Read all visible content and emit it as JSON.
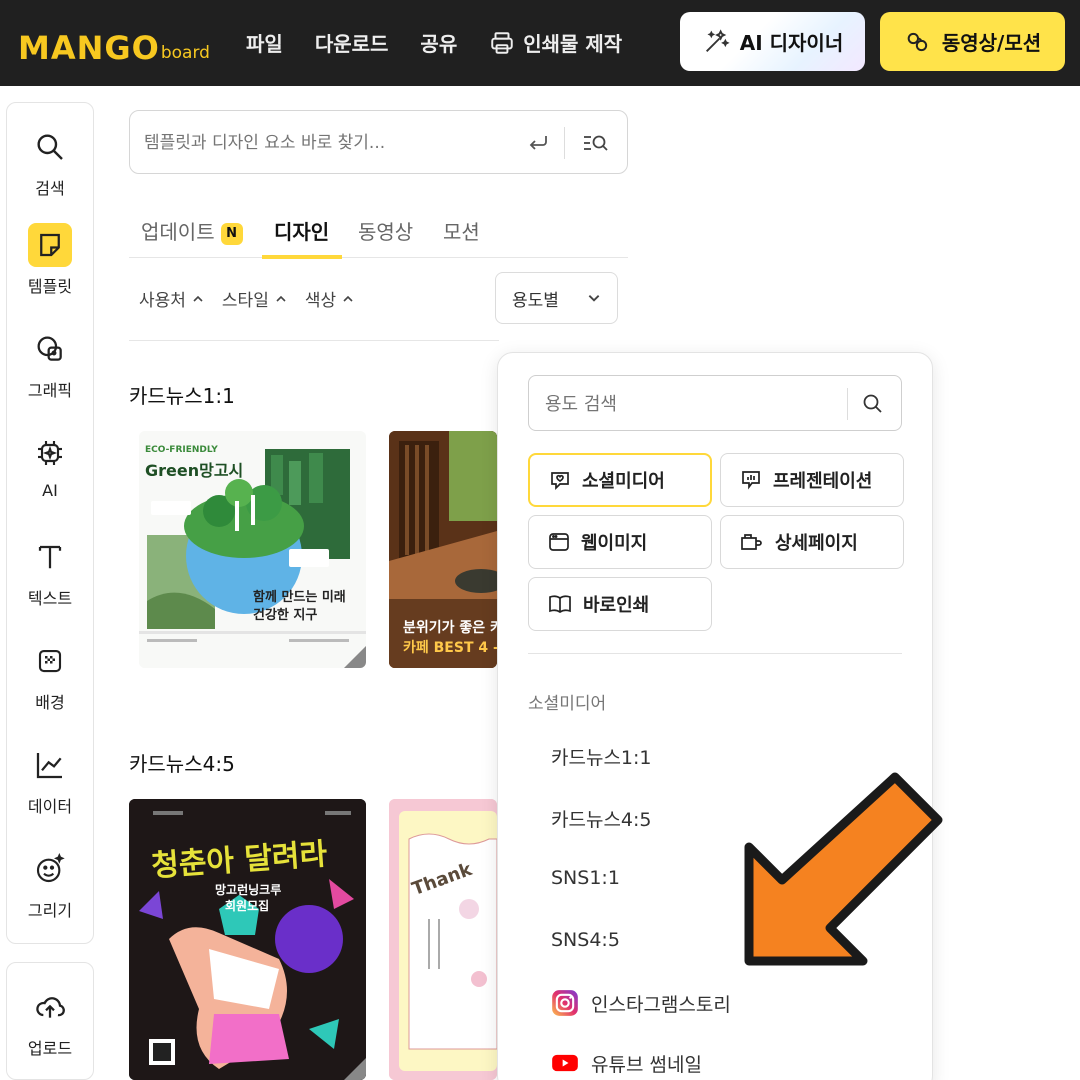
{
  "topbar": {
    "logo_main": "MANGO",
    "logo_sub": "board",
    "menu": [
      {
        "label": "파일"
      },
      {
        "label": "다운로드"
      },
      {
        "label": "공유"
      },
      {
        "label": "인쇄물 제작"
      }
    ],
    "ai_button": "AI 디자이너",
    "video_button": "동영상/모션"
  },
  "rail": {
    "items": [
      {
        "label": "검색",
        "icon": "search-icon"
      },
      {
        "label": "템플릿",
        "icon": "template-icon",
        "active": true
      },
      {
        "label": "그래픽",
        "icon": "graphic-icon"
      },
      {
        "label": "AI",
        "icon": "ai-chip-icon"
      },
      {
        "label": "텍스트",
        "icon": "text-icon"
      },
      {
        "label": "배경",
        "icon": "background-icon"
      },
      {
        "label": "데이터",
        "icon": "chart-icon"
      },
      {
        "label": "그리기",
        "icon": "draw-icon"
      }
    ],
    "upload": "업로드"
  },
  "search": {
    "placeholder": "템플릿과 디자인 요소 바로 찾기..."
  },
  "tabs": [
    {
      "label": "업데이트",
      "badge": "N"
    },
    {
      "label": "디자인",
      "active": true
    },
    {
      "label": "동영상"
    },
    {
      "label": "모션"
    }
  ],
  "filters": [
    {
      "label": "사용처"
    },
    {
      "label": "스타일"
    },
    {
      "label": "색상"
    }
  ],
  "use_select": {
    "value": "용도별"
  },
  "sections": [
    {
      "title": "카드뉴스1:1",
      "cards": [
        {
          "eyebrow": "ECO-FRIENDLY",
          "headline": "Green망고시",
          "caption_1": "함께 만드는 미래",
          "caption_2": "건강한 지구"
        },
        {
          "caption_1": "분위기가 좋은 카",
          "caption_2": "카페 BEST 4 -"
        }
      ]
    },
    {
      "title": "카드뉴스4:5",
      "cards": [
        {
          "headline": "청춘아 달려라",
          "sub_1": "망고런닝크루",
          "sub_2": "회원모집"
        },
        {
          "headline": "Thank"
        }
      ]
    }
  ],
  "dropdown": {
    "search_placeholder": "용도 검색",
    "chips": [
      {
        "label": "소셜미디어",
        "icon": "social-icon",
        "selected": true
      },
      {
        "label": "프레젠테이션",
        "icon": "presentation-icon"
      },
      {
        "label": "웹이미지",
        "icon": "web-image-icon"
      },
      {
        "label": "상세페이지",
        "icon": "detail-page-icon"
      },
      {
        "label": "바로인쇄",
        "icon": "print-book-icon"
      }
    ],
    "heading": "소셜미디어",
    "items": [
      {
        "label": "카드뉴스1:1"
      },
      {
        "label": "카드뉴스4:5"
      },
      {
        "label": "SNS1:1"
      },
      {
        "label": "SNS4:5"
      },
      {
        "label": "인스타그램스토리",
        "icon": "instagram-icon"
      },
      {
        "label": "유튜브 썸네일",
        "icon": "youtube-icon"
      }
    ]
  },
  "colors": {
    "accent": "#ffd83a",
    "topbar": "#202020",
    "arrow": "#f58220"
  }
}
